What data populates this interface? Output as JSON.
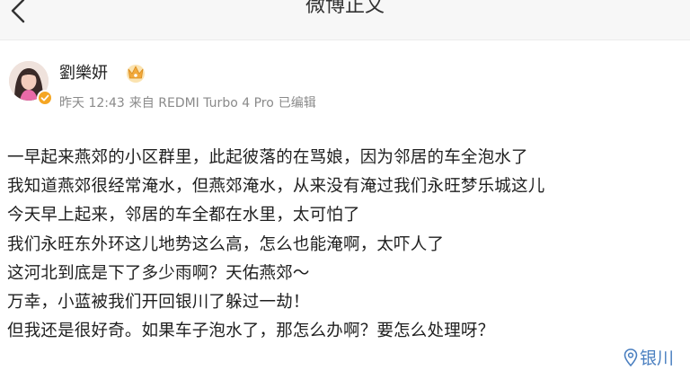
{
  "nav": {
    "back_icon": "chevron-left-icon",
    "title": "微博正文"
  },
  "author": {
    "name": "劉樂妍",
    "badge_icon": "crown-badge-icon",
    "verified_icon": "verified-badge-icon",
    "time": "昨天 12:43",
    "source": "来自 REDMI Turbo 4 Pro",
    "edited": "已编辑"
  },
  "post": {
    "lines": [
      "一早起来燕郊的小区群里，此起彼落的在骂娘，因为邻居的车全泡水了",
      "我知道燕郊很经常淹水，但燕郊淹水，从来没有淹过我们永旺梦乐城这儿",
      "今天早上起来，邻居的车全都在水里，太可怕了",
      "我们永旺东外环这儿地势这么高，怎么也能淹啊，太吓人了",
      "这河北到底是下了多少雨啊？天佑燕郊～",
      "万幸，小蓝被我们开回银川了躲过一劫！",
      "但我还是很好奇。如果车子泡水了，那怎么办啊？要怎么处理呀？"
    ],
    "location": "银川",
    "location_icon": "location-pin-icon"
  },
  "colors": {
    "link": "#4a7fc0",
    "meta": "#8a8a8a",
    "badge": "#f5a623"
  }
}
